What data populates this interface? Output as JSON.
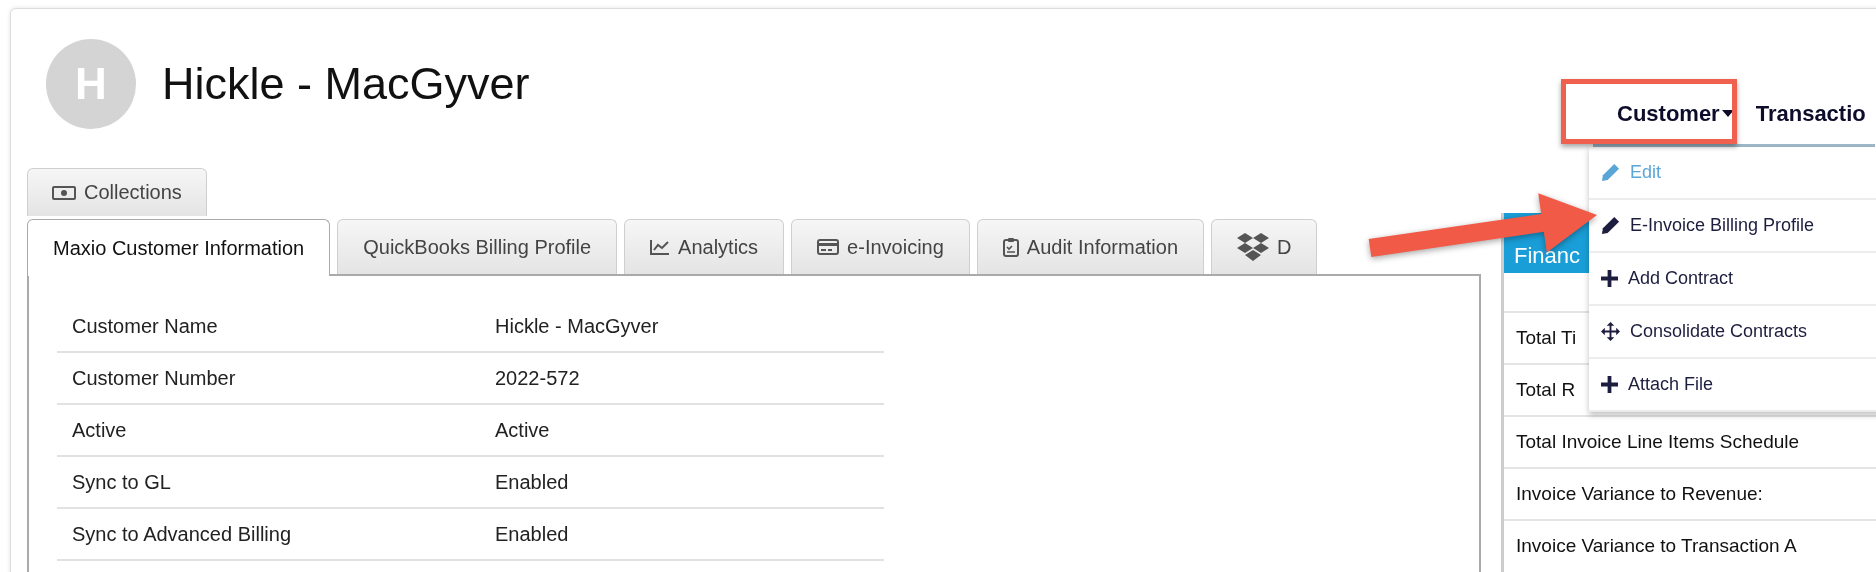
{
  "header": {
    "avatar_letter": "H",
    "title": "Hickle - MacGyver"
  },
  "nav": [
    {
      "label": "Customer",
      "dropdown": true
    },
    {
      "label": "Transactio",
      "dropdown": false
    }
  ],
  "menu": [
    {
      "label": "Edit",
      "kind": "pencil",
      "highlighted": true
    },
    {
      "label": "E-Invoice Billing Profile",
      "kind": "pencil",
      "highlighted": false
    },
    {
      "label": "Add Contract",
      "kind": "plus",
      "highlighted": false
    },
    {
      "label": "Consolidate Contracts",
      "kind": "move",
      "highlighted": false
    },
    {
      "label": "Attach File",
      "kind": "plus",
      "highlighted": false
    }
  ],
  "top_tabs": [
    {
      "label": "Collections",
      "kind": "money"
    }
  ],
  "tabs": [
    {
      "label": "Maxio Customer Information",
      "kind": "plain",
      "selected": true
    },
    {
      "label": "QuickBooks Billing Profile",
      "kind": "plain",
      "selected": false
    },
    {
      "label": "Analytics",
      "kind": "chart",
      "selected": false
    },
    {
      "label": "e-Invoicing",
      "kind": "card",
      "selected": false
    },
    {
      "label": "Audit Information",
      "kind": "clipboard",
      "selected": false
    },
    {
      "label": "D",
      "kind": "boxes",
      "selected": false
    }
  ],
  "details": [
    {
      "label": "Customer Name",
      "value": "Hickle - MacGyver"
    },
    {
      "label": "Customer Number",
      "value": "2022-572"
    },
    {
      "label": "Active",
      "value": "Active"
    },
    {
      "label": "Sync to GL",
      "value": "Enabled"
    },
    {
      "label": "Sync to Advanced Billing",
      "value": "Enabled"
    }
  ],
  "financial_panel": {
    "title": "Financ",
    "rows": [
      "Total Ti",
      "Total R",
      "Total Invoice Line Items Schedule",
      "Invoice Variance to Revenue:",
      "Invoice Variance to Transaction A"
    ]
  }
}
